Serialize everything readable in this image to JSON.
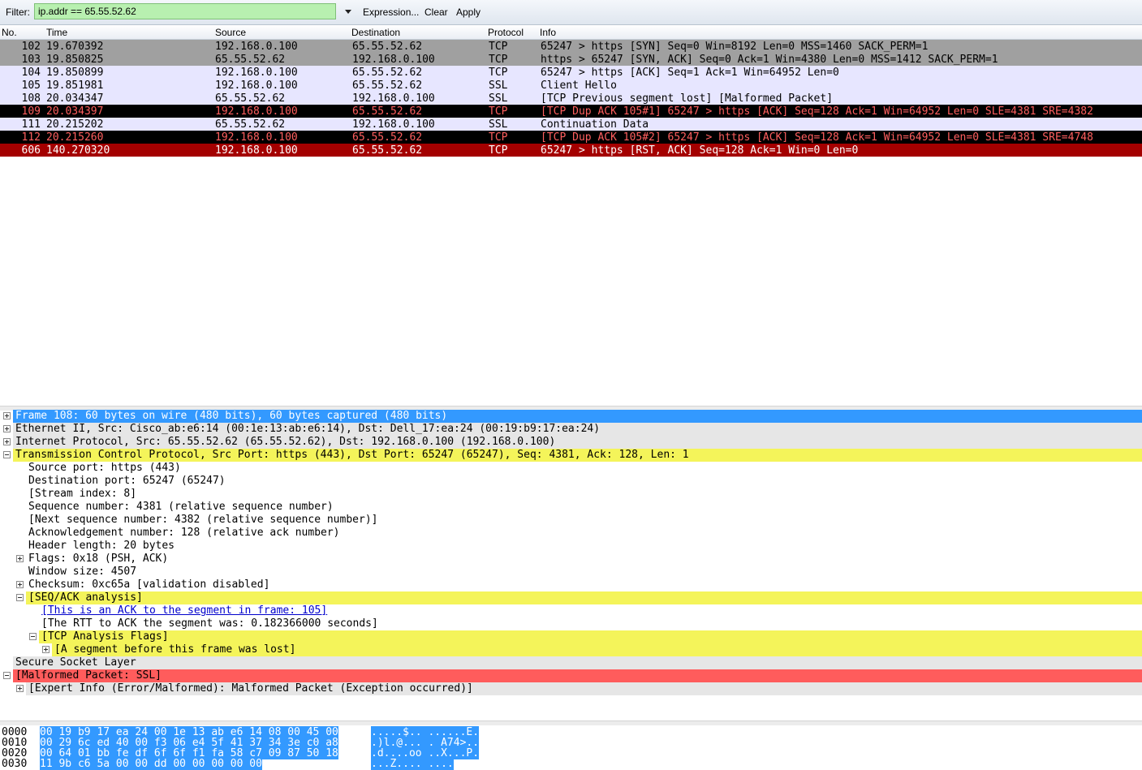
{
  "filter": {
    "label": "Filter:",
    "value": "ip.addr == 65.55.52.62",
    "expression": "Expression...",
    "clear": "Clear",
    "apply": "Apply"
  },
  "columns": {
    "no": "No.",
    "time": "Time",
    "source": "Source",
    "destination": "Destination",
    "protocol": "Protocol",
    "info": "Info"
  },
  "packets": [
    {
      "no": "102",
      "time": "19.670392",
      "src": "192.168.0.100",
      "dst": "65.55.52.62",
      "proto": "TCP",
      "info": "65247 > https [SYN] Seq=0 Win=8192 Len=0 MSS=1460 SACK_PERM=1",
      "bg": "#a0a0a0",
      "fg": "#000000"
    },
    {
      "no": "103",
      "time": "19.850825",
      "src": "65.55.52.62",
      "dst": "192.168.0.100",
      "proto": "TCP",
      "info": "https > 65247 [SYN, ACK] Seq=0 Ack=1 Win=4380 Len=0 MSS=1412 SACK_PERM=1",
      "bg": "#a0a0a0",
      "fg": "#000000"
    },
    {
      "no": "104",
      "time": "19.850899",
      "src": "192.168.0.100",
      "dst": "65.55.52.62",
      "proto": "TCP",
      "info": "65247 > https [ACK] Seq=1 Ack=1 Win=64952 Len=0",
      "bg": "#e7e6ff",
      "fg": "#000000"
    },
    {
      "no": "105",
      "time": "19.851981",
      "src": "192.168.0.100",
      "dst": "65.55.52.62",
      "proto": "SSL",
      "info": "Client Hello",
      "bg": "#e7e6ff",
      "fg": "#000000"
    },
    {
      "no": "108",
      "time": "20.034347",
      "src": "65.55.52.62",
      "dst": "192.168.0.100",
      "proto": "SSL",
      "info": "[TCP Previous segment lost] [Malformed Packet]",
      "bg": "#e7e6ff",
      "fg": "#000000"
    },
    {
      "no": "109",
      "time": "20.034397",
      "src": "192.168.0.100",
      "dst": "65.55.52.62",
      "proto": "TCP",
      "info": "[TCP Dup ACK 105#1] 65247 > https [ACK] Seq=128 Ack=1 Win=64952 Len=0 SLE=4381 SRE=4382",
      "bg": "#000000",
      "fg": "#ff5f5f"
    },
    {
      "no": "111",
      "time": "20.215202",
      "src": "65.55.52.62",
      "dst": "192.168.0.100",
      "proto": "SSL",
      "info": "Continuation Data",
      "bg": "#e7e6ff",
      "fg": "#000000"
    },
    {
      "no": "112",
      "time": "20.215260",
      "src": "192.168.0.100",
      "dst": "65.55.52.62",
      "proto": "TCP",
      "info": "[TCP Dup ACK 105#2] 65247 > https [ACK] Seq=128 Ack=1 Win=64952 Len=0 SLE=4381 SRE=4748",
      "bg": "#000000",
      "fg": "#ff5f5f"
    },
    {
      "no": "606",
      "time": "140.270320",
      "src": "192.168.0.100",
      "dst": "65.55.52.62",
      "proto": "TCP",
      "info": "65247 > https [RST, ACK] Seq=128 Ack=1 Win=0 Len=0",
      "bg": "#a40000",
      "fg": "#ffffff"
    }
  ],
  "details": [
    {
      "text": "Frame 108: 60 bytes on wire (480 bits), 60 bytes captured (480 bits)",
      "level": 0,
      "exp": "plus",
      "bg": "#3399ff",
      "fg": "#ffffff"
    },
    {
      "text": "Ethernet II, Src: Cisco_ab:e6:14 (00:1e:13:ab:e6:14), Dst: Dell_17:ea:24 (00:19:b9:17:ea:24)",
      "level": 0,
      "exp": "plus",
      "bg": "#e6e6e6",
      "fg": "#000000"
    },
    {
      "text": "Internet Protocol, Src: 65.55.52.62 (65.55.52.62), Dst: 192.168.0.100 (192.168.0.100)",
      "level": 0,
      "exp": "plus",
      "bg": "#e6e6e6",
      "fg": "#000000"
    },
    {
      "text": "Transmission Control Protocol, Src Port: https (443), Dst Port: 65247 (65247), Seq: 4381, Ack: 128, Len: 1",
      "level": 0,
      "exp": "minus",
      "bg": "#f4f45a",
      "fg": "#000000"
    },
    {
      "text": "Source port: https (443)",
      "level": 1,
      "exp": "",
      "bg": "",
      "fg": "#000000"
    },
    {
      "text": "Destination port: 65247 (65247)",
      "level": 1,
      "exp": "",
      "bg": "",
      "fg": "#000000"
    },
    {
      "text": "[Stream index: 8]",
      "level": 1,
      "exp": "",
      "bg": "",
      "fg": "#000000"
    },
    {
      "text": "Sequence number: 4381    (relative sequence number)",
      "level": 1,
      "exp": "",
      "bg": "",
      "fg": "#000000"
    },
    {
      "text": "[Next sequence number: 4382    (relative sequence number)]",
      "level": 1,
      "exp": "",
      "bg": "",
      "fg": "#000000"
    },
    {
      "text": "Acknowledgement number: 128    (relative ack number)",
      "level": 1,
      "exp": "",
      "bg": "",
      "fg": "#000000"
    },
    {
      "text": "Header length: 20 bytes",
      "level": 1,
      "exp": "",
      "bg": "",
      "fg": "#000000"
    },
    {
      "text": "Flags: 0x18 (PSH, ACK)",
      "level": 1,
      "exp": "plus",
      "bg": "",
      "fg": "#000000"
    },
    {
      "text": "Window size: 4507",
      "level": 1,
      "exp": "",
      "bg": "",
      "fg": "#000000"
    },
    {
      "text": "Checksum: 0xc65a [validation disabled]",
      "level": 1,
      "exp": "plus",
      "bg": "",
      "fg": "#000000"
    },
    {
      "text": "[SEQ/ACK analysis]",
      "level": 1,
      "exp": "minus",
      "bg": "#f4f45a",
      "fg": "#000000"
    },
    {
      "text": "[This is an ACK to the segment in frame: 105]",
      "level": 2,
      "exp": "",
      "bg": "",
      "fg": "#0000cc",
      "link": true
    },
    {
      "text": "[The RTT to ACK the segment was: 0.182366000 seconds]",
      "level": 2,
      "exp": "",
      "bg": "",
      "fg": "#000000"
    },
    {
      "text": "[TCP Analysis Flags]",
      "level": 2,
      "exp": "minus",
      "bg": "#f4f45a",
      "fg": "#000000"
    },
    {
      "text": "[A segment before this frame was lost]",
      "level": 3,
      "exp": "plus",
      "bg": "#f4f45a",
      "fg": "#000000"
    },
    {
      "text": "Secure Socket Layer",
      "level": 0,
      "exp": "",
      "bg": "#e6e6e6",
      "fg": "#000000"
    },
    {
      "text": "[Malformed Packet: SSL]",
      "level": 0,
      "exp": "minus",
      "bg": "#ff5c5c",
      "fg": "#000000"
    },
    {
      "text": "[Expert Info (Error/Malformed): Malformed Packet (Exception occurred)]",
      "level": 1,
      "exp": "plus",
      "bg": "#e6e6e6",
      "fg": "#000000"
    }
  ],
  "hex": [
    {
      "offset": "0000",
      "bytes": "00 19 b9 17 ea 24 00 1e  13 ab e6 14 08 00 45 00",
      "ascii": ".....$.. ......E."
    },
    {
      "offset": "0010",
      "bytes": "00 29 6c ed 40 00 f3 06  e4 5f 41 37 34 3e c0 a8",
      "ascii": ".)l.@... ._A74>.."
    },
    {
      "offset": "0020",
      "bytes": "00 64 01 bb fe df 6f 6f  f1 fa 58 c7 09 87 50 18",
      "ascii": ".d....oo ..X...P."
    },
    {
      "offset": "0030",
      "bytes": "11 9b c6 5a 00 00 dd 00  00 00 00 00",
      "ascii": "...Z.... ...."
    }
  ]
}
